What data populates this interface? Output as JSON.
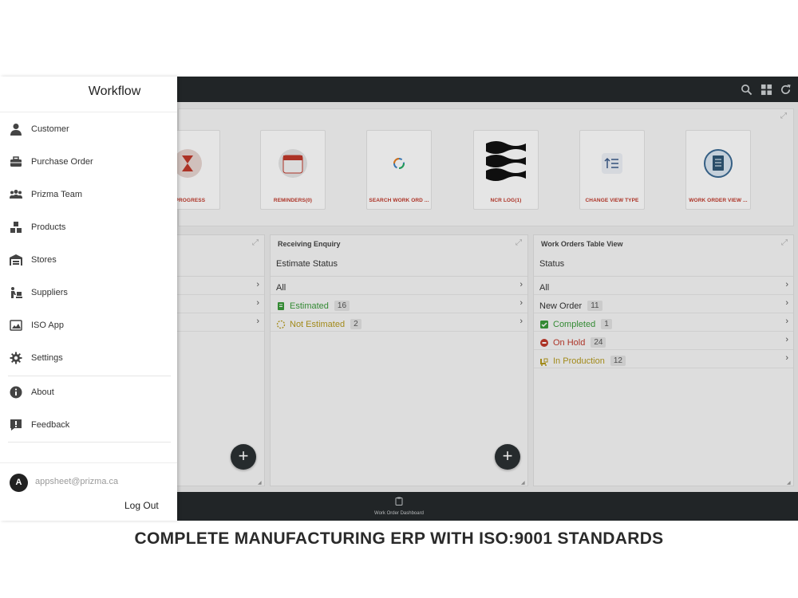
{
  "app": {
    "toolbar_icons": [
      "search-icon",
      "grid-icon",
      "refresh-icon"
    ],
    "tiles": [
      {
        "label": "N PROGRESS",
        "icon": "hourglass-icon"
      },
      {
        "label": "REMINDERS(0)",
        "icon": "calendar-icon"
      },
      {
        "label": "SEARCH WORK ORD ...",
        "icon": "search-spinner-icon"
      },
      {
        "label": "NCR LOG(1)",
        "icon": "ncr-waves-icon"
      },
      {
        "label": "CHANGE VIEW TYPE",
        "icon": "view-type-icon"
      },
      {
        "label": "WORK ORDER VIEW ...",
        "icon": "document-icon"
      }
    ],
    "columns": {
      "left": {
        "title": "",
        "subtitle": ""
      },
      "middle": {
        "title": "Receiving Enquiry",
        "subtitle": "Estimate Status",
        "rows": [
          {
            "label": "All",
            "count": ""
          },
          {
            "label": "Estimated",
            "count": "16",
            "color": "#3a9a3a"
          },
          {
            "label": "Not Estimated",
            "count": "2",
            "color": "#b59a1e"
          }
        ]
      },
      "right": {
        "title": "Work Orders Table View",
        "subtitle": "Status",
        "rows": [
          {
            "label": "All",
            "count": ""
          },
          {
            "label": "New Order",
            "count": "11",
            "color": "#333333"
          },
          {
            "label": "Completed",
            "count": "1",
            "color": "#3a9a3a"
          },
          {
            "label": "On Hold",
            "count": "24",
            "color": "#c0392b"
          },
          {
            "label": "In Production",
            "count": "12",
            "color": "#b59a1e"
          }
        ]
      }
    },
    "bottom_nav": {
      "label": "Work Order Dashboard"
    }
  },
  "drawer": {
    "title": "Workflow",
    "items": [
      {
        "label": "Customer",
        "icon": "person-icon"
      },
      {
        "label": "Purchase Order",
        "icon": "briefcase-icon"
      },
      {
        "label": "Prizma Team",
        "icon": "team-icon"
      },
      {
        "label": "Products",
        "icon": "boxes-icon"
      },
      {
        "label": "Stores",
        "icon": "warehouse-icon"
      },
      {
        "label": "Suppliers",
        "icon": "supplier-icon"
      },
      {
        "label": "ISO App",
        "icon": "image-icon"
      },
      {
        "label": "Settings",
        "icon": "gear-icon"
      },
      {
        "label": "About",
        "icon": "info-icon"
      },
      {
        "label": "Feedback",
        "icon": "feedback-icon"
      }
    ],
    "account": {
      "avatar_letter": "A",
      "email": "appsheet@prizma.ca",
      "logout_label": "Log Out"
    }
  },
  "caption": "COMPLETE MANUFACTURING ERP WITH ISO:9001 STANDARDS"
}
